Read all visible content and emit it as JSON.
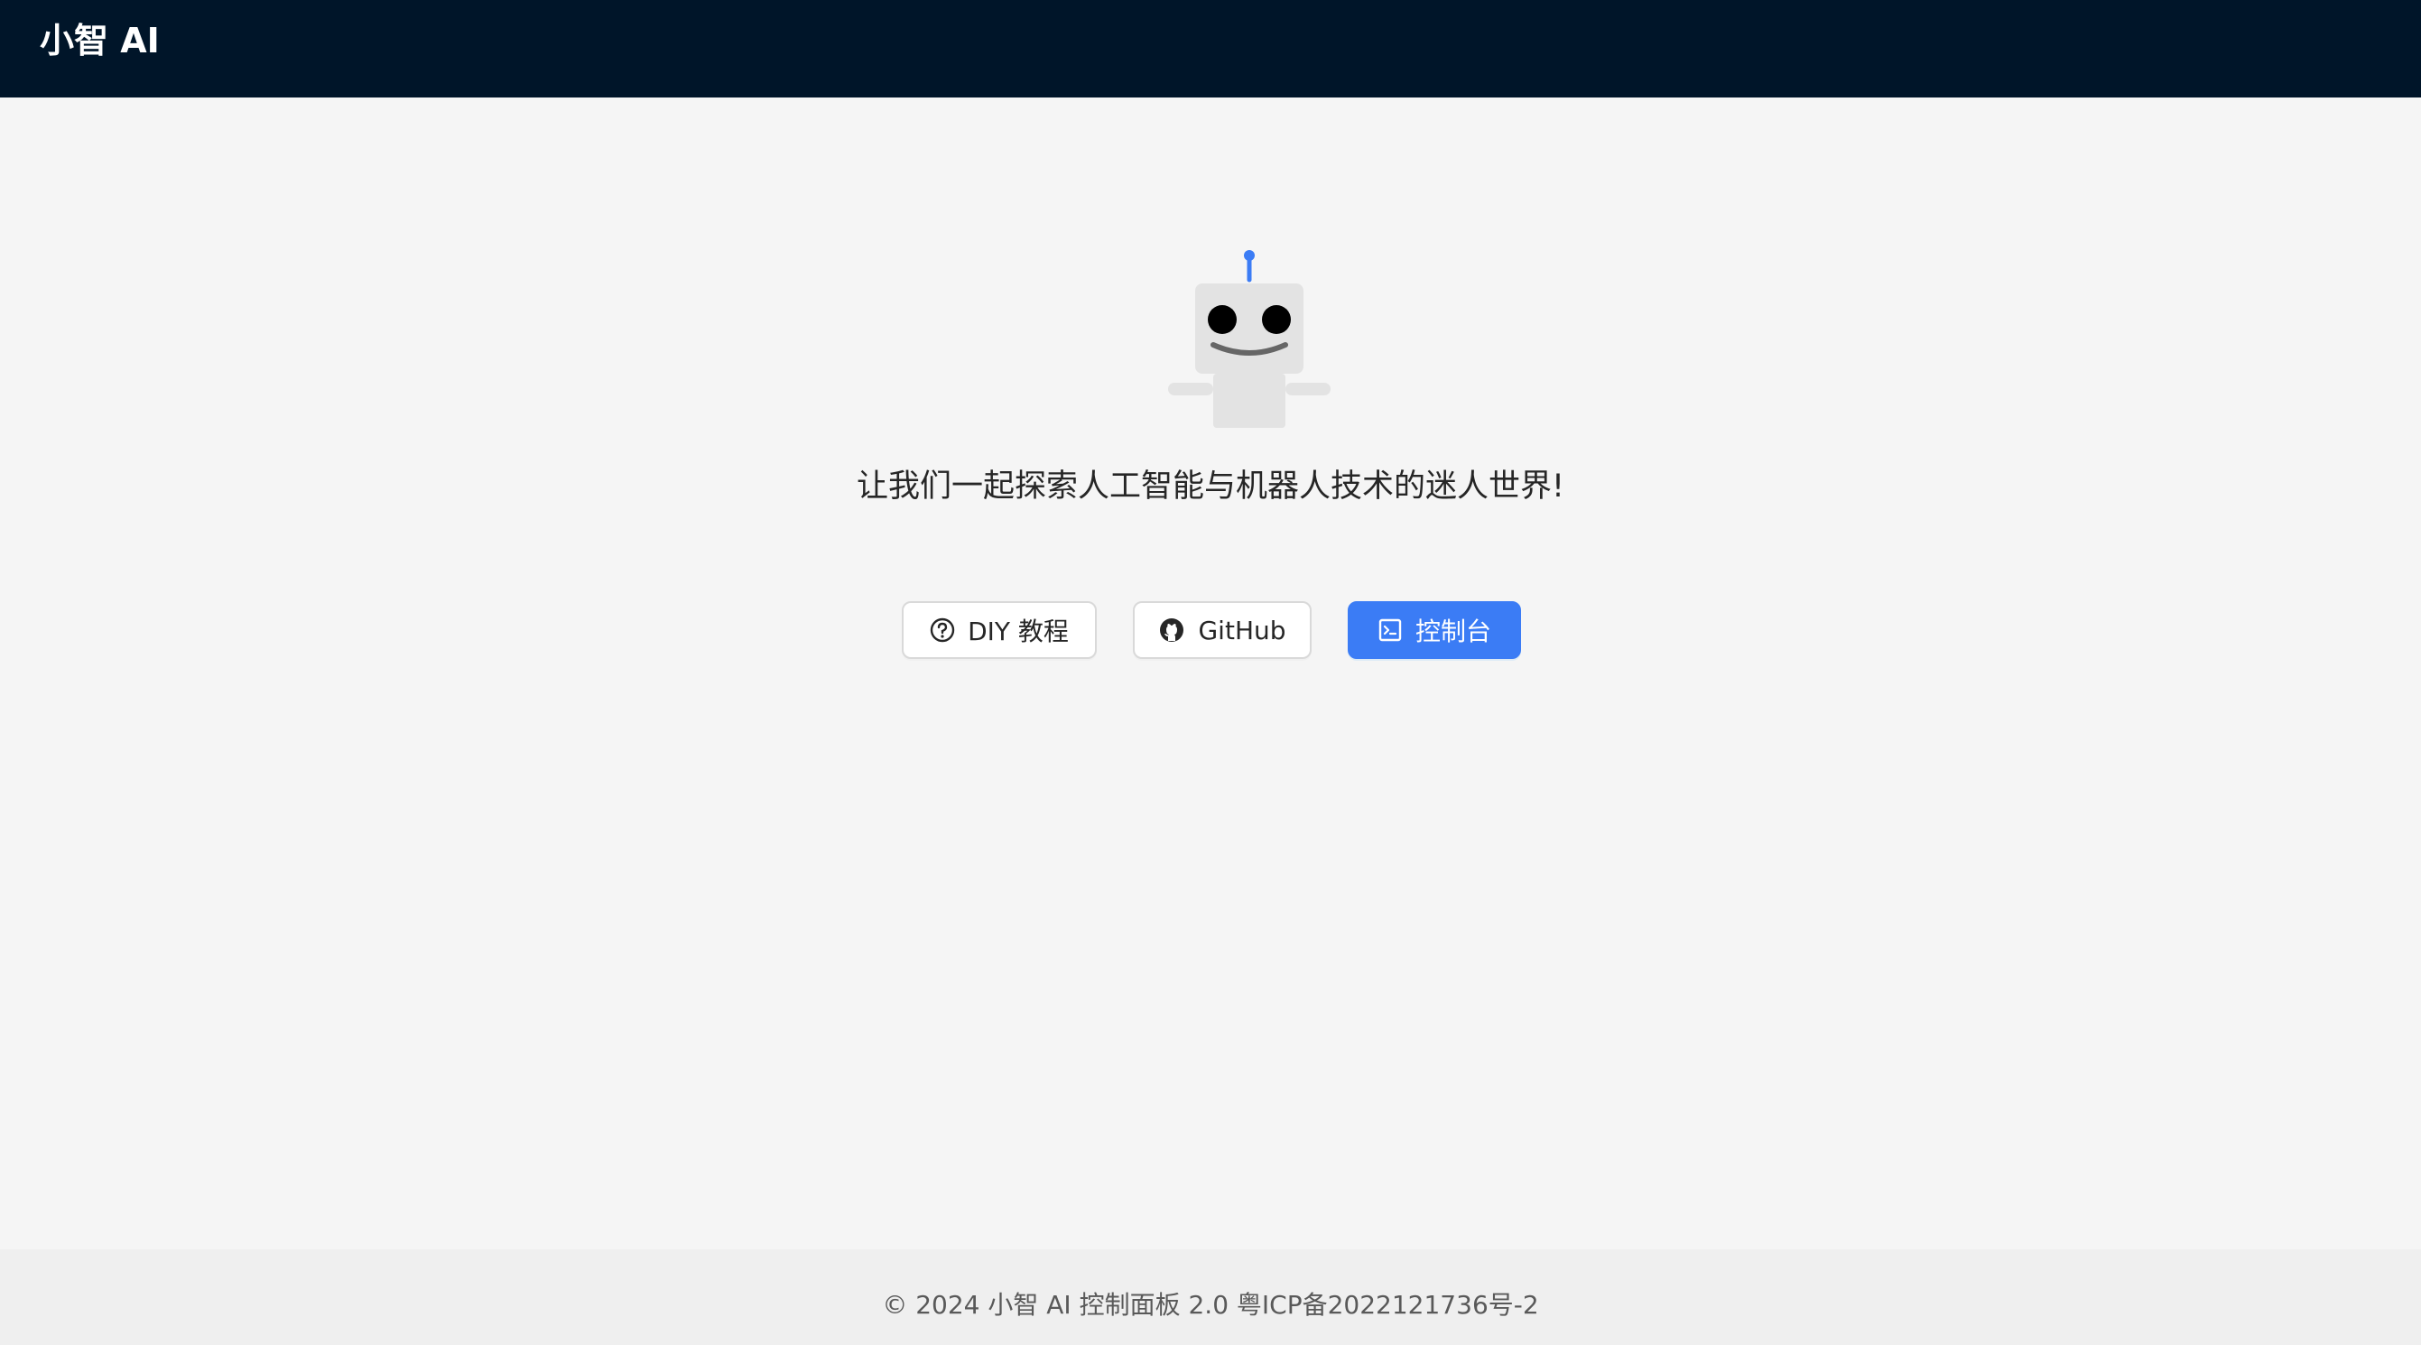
{
  "header": {
    "brand": "小智 AI"
  },
  "hero": {
    "illustration": "robot-icon",
    "tagline": "让我们一起探索人工智能与机器人技术的迷人世界!"
  },
  "actions": [
    {
      "label": "DIY 教程",
      "icon": "question-circle-icon"
    },
    {
      "label": "GitHub",
      "icon": "github-icon"
    },
    {
      "label": "控制台",
      "icon": "code-console-icon"
    }
  ],
  "footer": {
    "copyright": "© 2024 小智 AI 控制面板 2.0 粤ICP备2022121736号-2"
  },
  "colors": {
    "header_bg": "#001529",
    "primary": "#3b7cf5",
    "page_bg": "#f5f5f5",
    "footer_bg": "#efefef"
  }
}
